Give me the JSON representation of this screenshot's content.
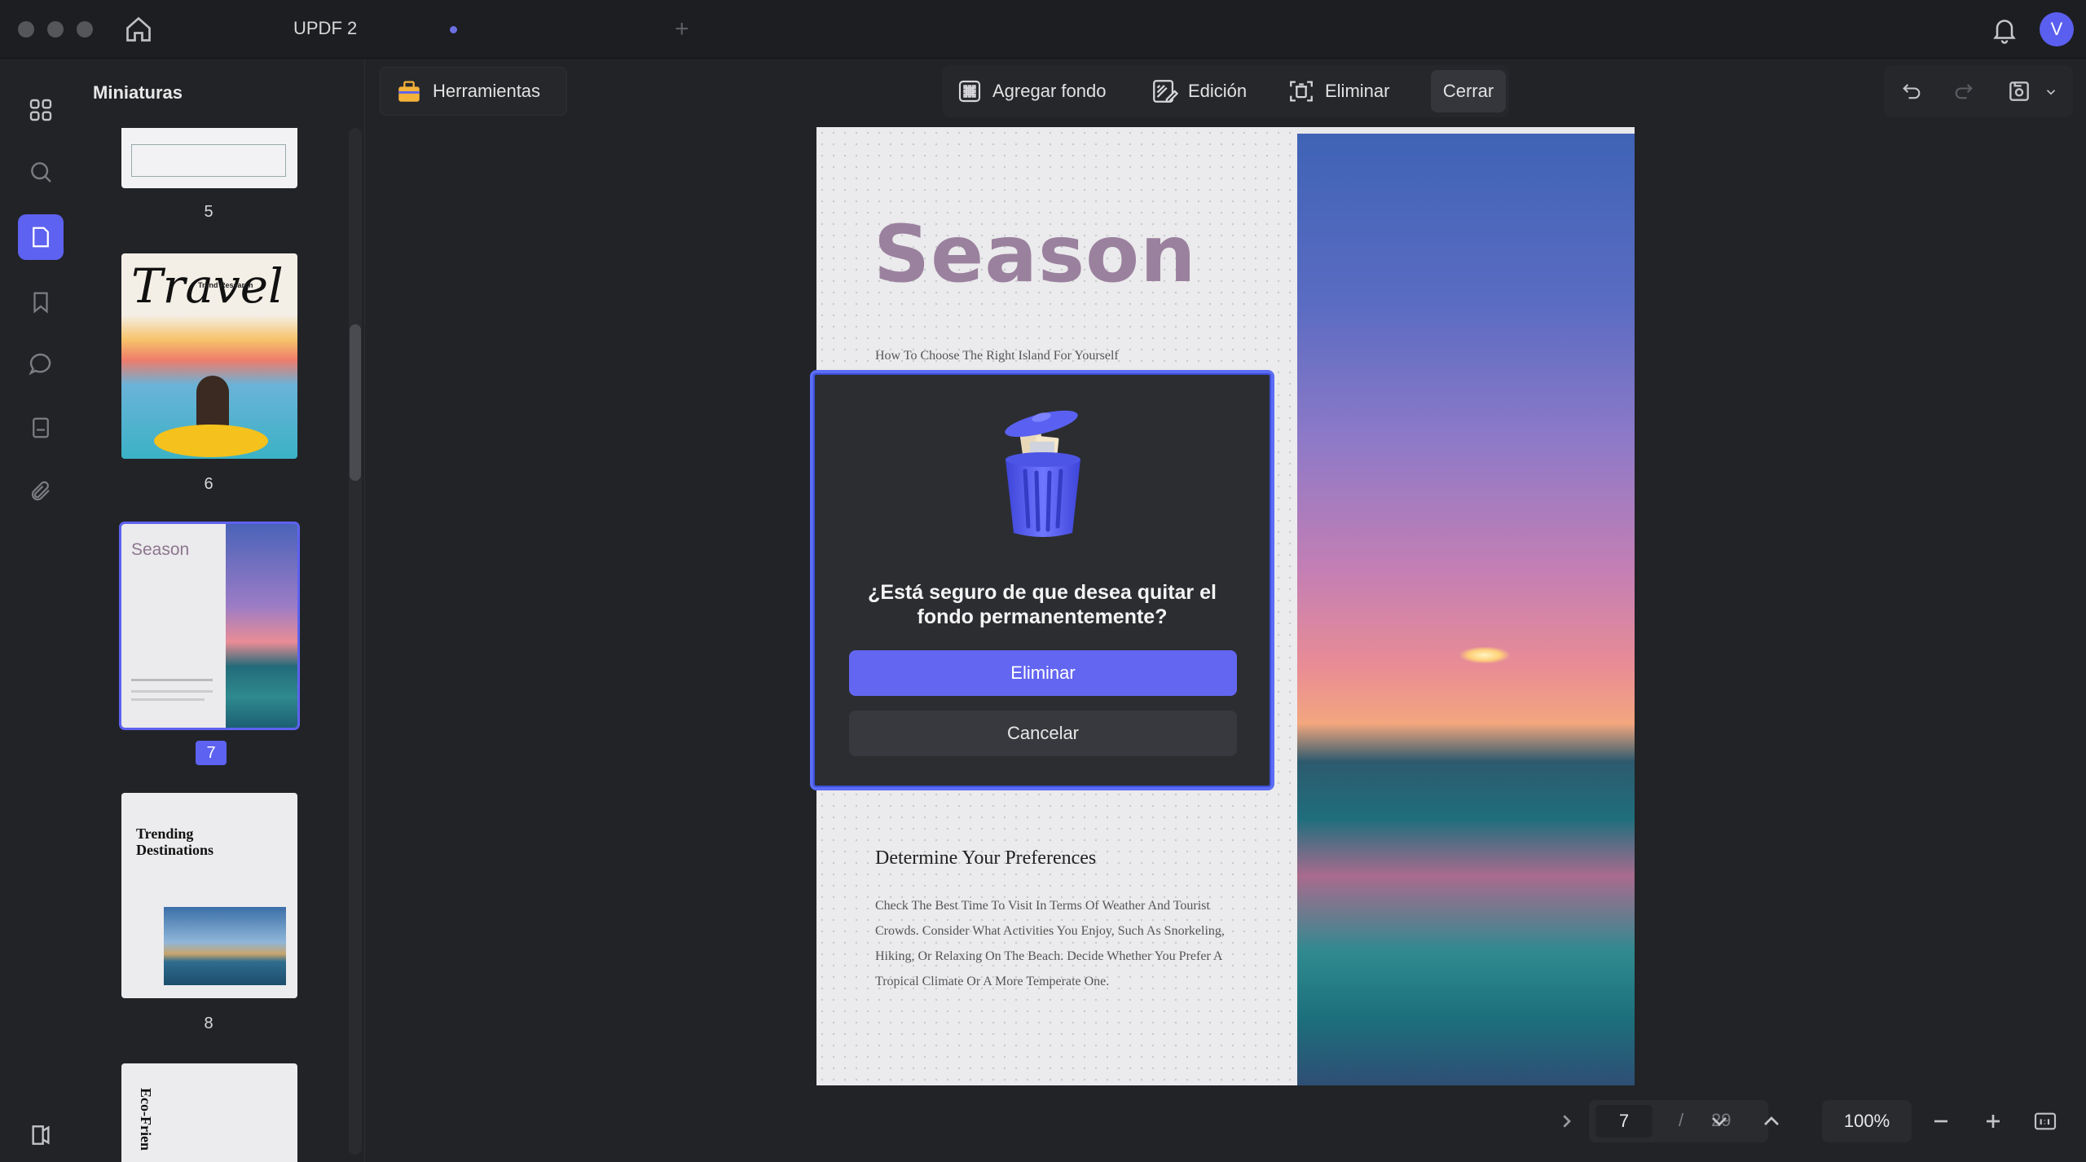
{
  "app": {
    "tab_title": "UPDF 2",
    "avatar_initial": "V"
  },
  "sidebar": {
    "panel_title": "Miniaturas",
    "thumbnails": [
      {
        "number": "5"
      },
      {
        "number": "6",
        "title": "Travel",
        "subtitle": "Trend Research"
      },
      {
        "number": "7",
        "title": "Season",
        "selected": true
      },
      {
        "number": "8",
        "title": "Trending Destinations"
      },
      {
        "number": "9",
        "title": "Eco-Frien"
      }
    ]
  },
  "toolbar": {
    "tools_label": "Herramientas",
    "add_background_label": "Agregar fondo",
    "edit_label": "Edición",
    "remove_label": "Eliminar",
    "close_label": "Cerrar"
  },
  "document": {
    "title": "Season",
    "subtitle": "How To Choose The Right Island For Yourself",
    "section_title": "Determine Your Preferences",
    "section_body": "Check The Best Time To Visit In Terms Of Weather And Tourist Crowds. Consider What Activities You Enjoy, Such As Snorkeling, Hiking, Or Relaxing On The Beach. Decide Whether You Prefer A Tropical Climate Or A More Temperate One."
  },
  "dialog": {
    "question_line1": "¿Está seguro de que desea quitar el",
    "question_line2": "fondo permanentemente?",
    "confirm_label": "Eliminar",
    "cancel_label": "Cancelar"
  },
  "navigation": {
    "current_page": "7",
    "separator": "/",
    "total_pages": "29",
    "zoom": "100%"
  },
  "colors": {
    "accent": "#6366f1",
    "dialog_border": "#5b6cf5",
    "background": "#222327"
  }
}
